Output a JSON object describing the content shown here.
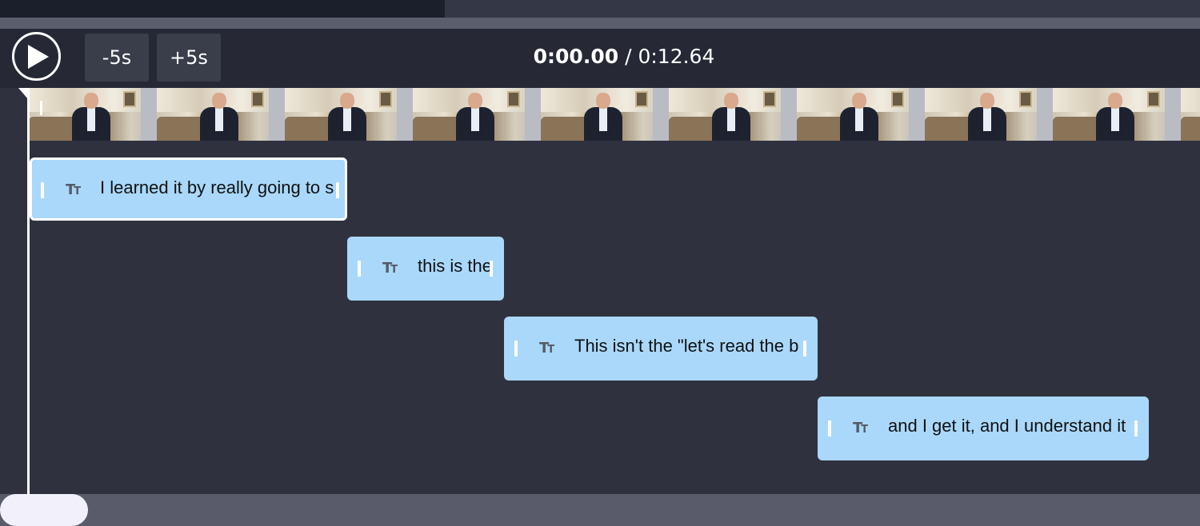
{
  "controls": {
    "skip_back_label": "-5s",
    "skip_forward_label": "+5s",
    "current_time": "0:00.00",
    "separator": " / ",
    "total_time": "0:12.64"
  },
  "caption_icon": "Tt",
  "captions": [
    {
      "text": "I learned it by really going to s",
      "selected": true
    },
    {
      "text": "this is the",
      "selected": false
    },
    {
      "text": "This isn't the \"let's read the b",
      "selected": false
    },
    {
      "text": "and I get it, and I understand it",
      "selected": false
    }
  ],
  "colors": {
    "caption_bg": "#a9d8fa",
    "timeline_bg": "#2f323e",
    "controls_bg": "#262935"
  }
}
